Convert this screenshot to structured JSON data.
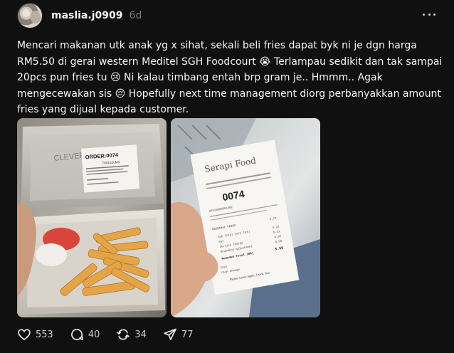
{
  "post": {
    "username": "maslia.j0909",
    "time_ago": "6d",
    "text": "Mencari makanan utk anak yg x sihat, sekali beli fries dapat byk ni je dgn harga RM5.50 di gerai western Meditel SGH Foodcourt 😭 Terlampau sedikit dan tak sampai 20pcs pun fries tu 😢 Ni kalau timbang entah brp gram je.. Hmmm.. Agak mengecewakan sis 😔 Hopefully next time management diorg perbanyakkan amount fries yang dijual kepada customer."
  },
  "photo1": {
    "order_title": "ORDER:0074",
    "order_sub": "T001S2uM4",
    "lid_word": "CLEVER"
  },
  "photo2": {
    "brand": "Serapi Food",
    "order_number": "0074",
    "receipt_id": "SPV10080051482",
    "item": "ORIGINAL FRIES",
    "item_amount": "4.72",
    "rows": [
      {
        "label": "Sub Total (w/o tax)",
        "value": "5.21"
      },
      {
        "label": "SST",
        "value": "0.21"
      },
      {
        "label": "Service Charge",
        "value": "0.00"
      },
      {
        "label": "Rounding Adjustment",
        "value": "0.00"
      }
    ],
    "total_label": "Rounded Total (RM)",
    "total_value": "5.50",
    "cash_label": "Cash",
    "change_label": "Cash Change",
    "thanks": "Please Come Again, Thank You!"
  },
  "actions": {
    "likes": "553",
    "comments": "40",
    "reposts": "34",
    "shares": "77"
  },
  "icons": {
    "like": "heart-icon",
    "comment": "comment-icon",
    "repost": "repost-icon",
    "share": "share-icon",
    "more": "more-options-icon"
  },
  "colors": {
    "background": "#101010",
    "text": "#f3f5f7",
    "muted": "#777777"
  }
}
